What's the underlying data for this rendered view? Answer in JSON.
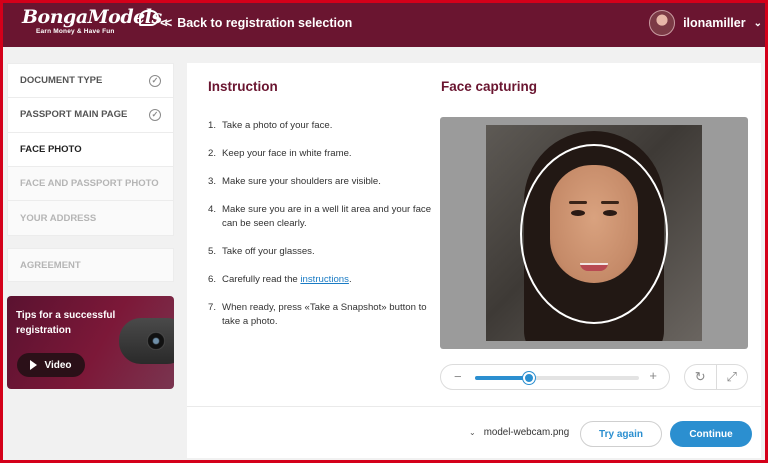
{
  "header": {
    "logo_text": "BongaModels",
    "logo_tagline": "Earn Money & Have Fun",
    "back_label": "Back to registration selection",
    "username": "ilonamiller"
  },
  "sidebar": {
    "steps": [
      {
        "label": "DOCUMENT TYPE",
        "state": "done"
      },
      {
        "label": "PASSPORT MAIN PAGE",
        "state": "done"
      },
      {
        "label": "FACE PHOTO",
        "state": "current"
      },
      {
        "label": "FACE AND PASSPORT PHOTO",
        "state": "disabled"
      },
      {
        "label": "YOUR ADDRESS",
        "state": "disabled"
      }
    ],
    "agreement_label": "AGREEMENT",
    "tips": {
      "title": "Tips for a successful registration",
      "video_label": "Video"
    }
  },
  "instruction": {
    "heading": "Instruction",
    "items": [
      {
        "num": "1.",
        "text": "Take a photo of your face."
      },
      {
        "num": "2.",
        "text": "Keep your face in white frame."
      },
      {
        "num": "3.",
        "text": "Make sure your shoulders are visible."
      },
      {
        "num": "4.",
        "text": "Make sure you are in a well lit area and your face can be seen clearly."
      },
      {
        "num": "5.",
        "text": "Take off your glasses."
      },
      {
        "num": "6.",
        "text_before": "Carefully read the ",
        "link": "instructions",
        "text_after": "."
      },
      {
        "num": "7.",
        "text": "When ready, press «Take a Snapshot» button to take a photo."
      }
    ]
  },
  "capture": {
    "heading": "Face capturing",
    "zoom_minus": "−",
    "zoom_plus": "+",
    "zoom_level": 0.33,
    "rotate_icon": "↻",
    "flip_icon": "⤢"
  },
  "footer": {
    "file_name": "model-webcam.png",
    "try_again_label": "Try again",
    "continue_label": "Continue"
  },
  "colors": {
    "header_bg": "#6a1530",
    "accent_blue": "#2b8fd0",
    "frame_border": "#d4001a"
  }
}
